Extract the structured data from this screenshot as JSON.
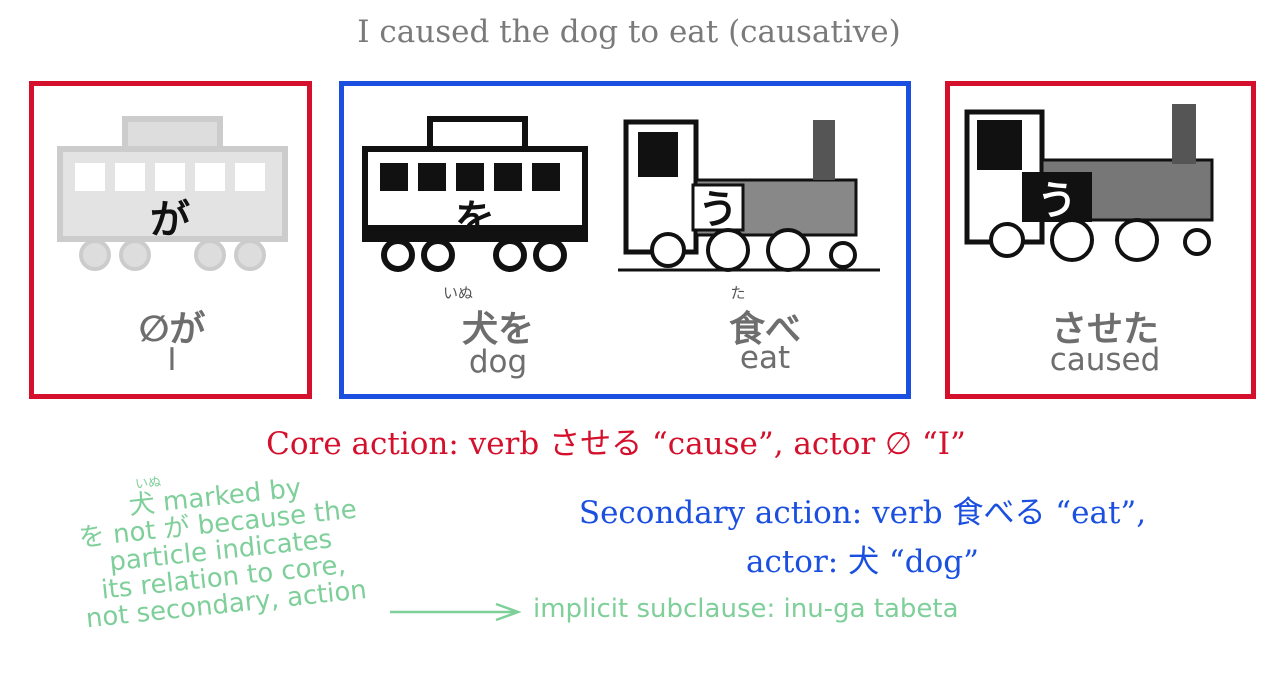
{
  "title": "I caused the dog to eat (causative)",
  "panels": {
    "subject": {
      "train_label": "が",
      "word": "∅が",
      "gloss": "I"
    },
    "object": {
      "train_label": "を",
      "ruby": "いぬ",
      "word": "犬を",
      "gloss": "dog"
    },
    "verb": {
      "train_label": "う",
      "ruby": "た",
      "word": "食べ",
      "gloss": "eat"
    },
    "causative": {
      "train_label": "う",
      "word": "させた",
      "gloss": "caused"
    }
  },
  "core_action": "Core action: verb させる “cause”, actor ∅ “I”",
  "secondary_action": {
    "line1": "Secondary action: verb 食べる “eat”,",
    "line2": "actor: 犬 “dog”"
  },
  "note": {
    "ruby": "いぬ",
    "lines": [
      "犬 marked by",
      "を not が because the",
      "particle indicates",
      "its relation to core,",
      "not secondary, action"
    ]
  },
  "implicit": "implicit subclause: inu-ga tabeta",
  "colors": {
    "core": "#d5102c",
    "secondary": "#1a4fe0",
    "note": "#7fcf9a",
    "title": "#7a7a7a"
  }
}
